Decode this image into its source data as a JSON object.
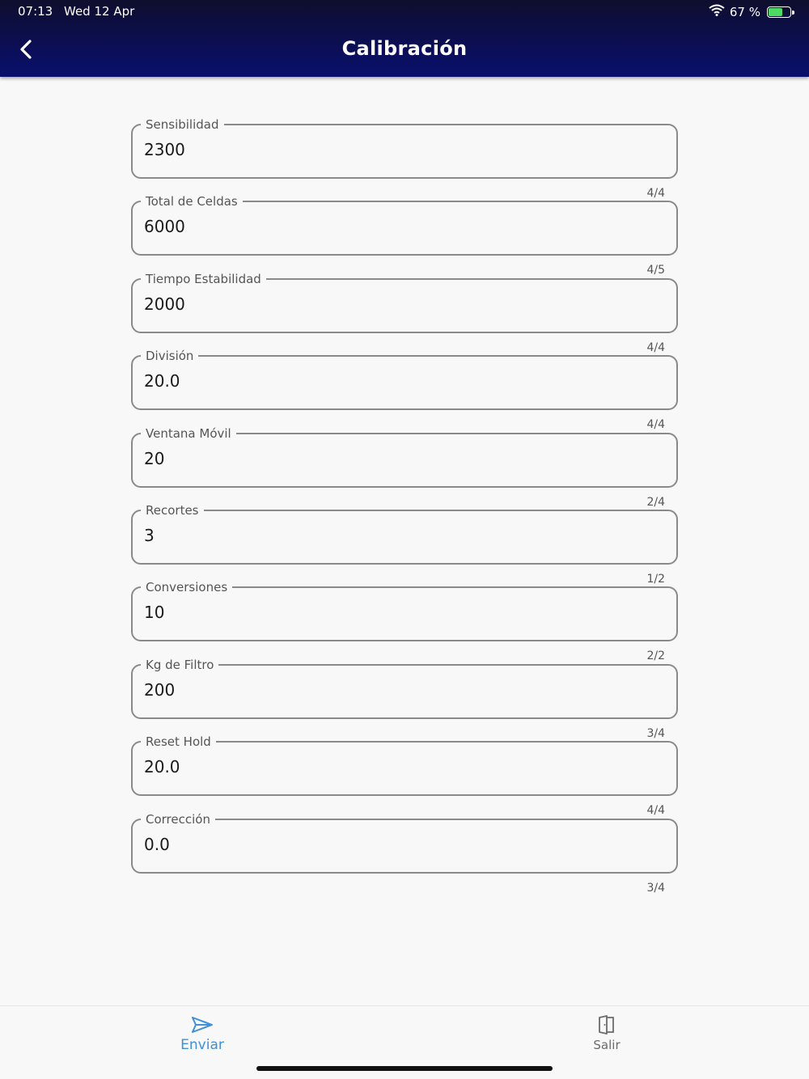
{
  "status_bar": {
    "time": "07:13",
    "date": "Wed 12 Apr",
    "battery_text": "67 %",
    "battery_level": 0.67
  },
  "header": {
    "title": "Calibración"
  },
  "fields": [
    {
      "label": "Sensibilidad",
      "value": "2300",
      "counter": "4/4"
    },
    {
      "label": "Total de Celdas",
      "value": "6000",
      "counter": "4/5"
    },
    {
      "label": "Tiempo Estabilidad",
      "value": "2000",
      "counter": "4/4"
    },
    {
      "label": "División",
      "value": "20.0",
      "counter": "4/4"
    },
    {
      "label": "Ventana Móvil",
      "value": "20",
      "counter": "2/4"
    },
    {
      "label": "Recortes",
      "value": "3",
      "counter": "1/2"
    },
    {
      "label": "Conversiones",
      "value": "10",
      "counter": "2/2"
    },
    {
      "label": "Kg de Filtro",
      "value": "200",
      "counter": "3/4"
    },
    {
      "label": "Reset Hold",
      "value": "20.0",
      "counter": "4/4"
    },
    {
      "label": "Corrección",
      "value": "0.0",
      "counter": "3/4"
    }
  ],
  "bottom_nav": {
    "send": {
      "label": "Enviar",
      "icon": "send-icon",
      "color": "#3f8fd9"
    },
    "exit": {
      "label": "Salir",
      "icon": "exit-door-icon",
      "color": "#6b6b6b"
    }
  }
}
